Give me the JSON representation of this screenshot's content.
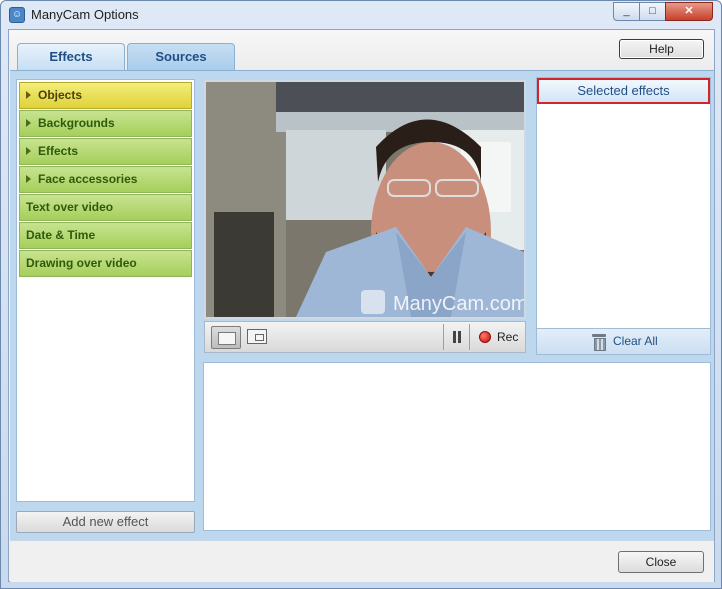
{
  "window": {
    "title": "ManyCam Options",
    "controls": {
      "minimize": "_",
      "maximize": "□",
      "close": "✕"
    }
  },
  "tabs": [
    {
      "label": "Effects",
      "active": true
    },
    {
      "label": "Sources",
      "active": false
    }
  ],
  "help_button": "Help",
  "categories": [
    {
      "label": "Objects",
      "expandable": true,
      "active": true
    },
    {
      "label": "Backgrounds",
      "expandable": true,
      "active": false
    },
    {
      "label": "Effects",
      "expandable": true,
      "active": false
    },
    {
      "label": "Face accessories",
      "expandable": true,
      "active": false
    },
    {
      "label": "Text over video",
      "expandable": false,
      "active": false
    },
    {
      "label": "Date & Time",
      "expandable": false,
      "active": false
    },
    {
      "label": "Drawing over video",
      "expandable": false,
      "active": false
    }
  ],
  "add_effect_button": "Add new effect",
  "video": {
    "watermark": "ManyCam.com",
    "record_label": "Rec"
  },
  "selected_effects": {
    "header": "Selected effects",
    "clear_label": "Clear All"
  },
  "close_button": "Close",
  "colors": {
    "accent_blue": "#bcd7ee",
    "category_green": "#a6cf5b",
    "category_active_yellow": "#dfd23a",
    "highlight_red": "#d2252b"
  }
}
